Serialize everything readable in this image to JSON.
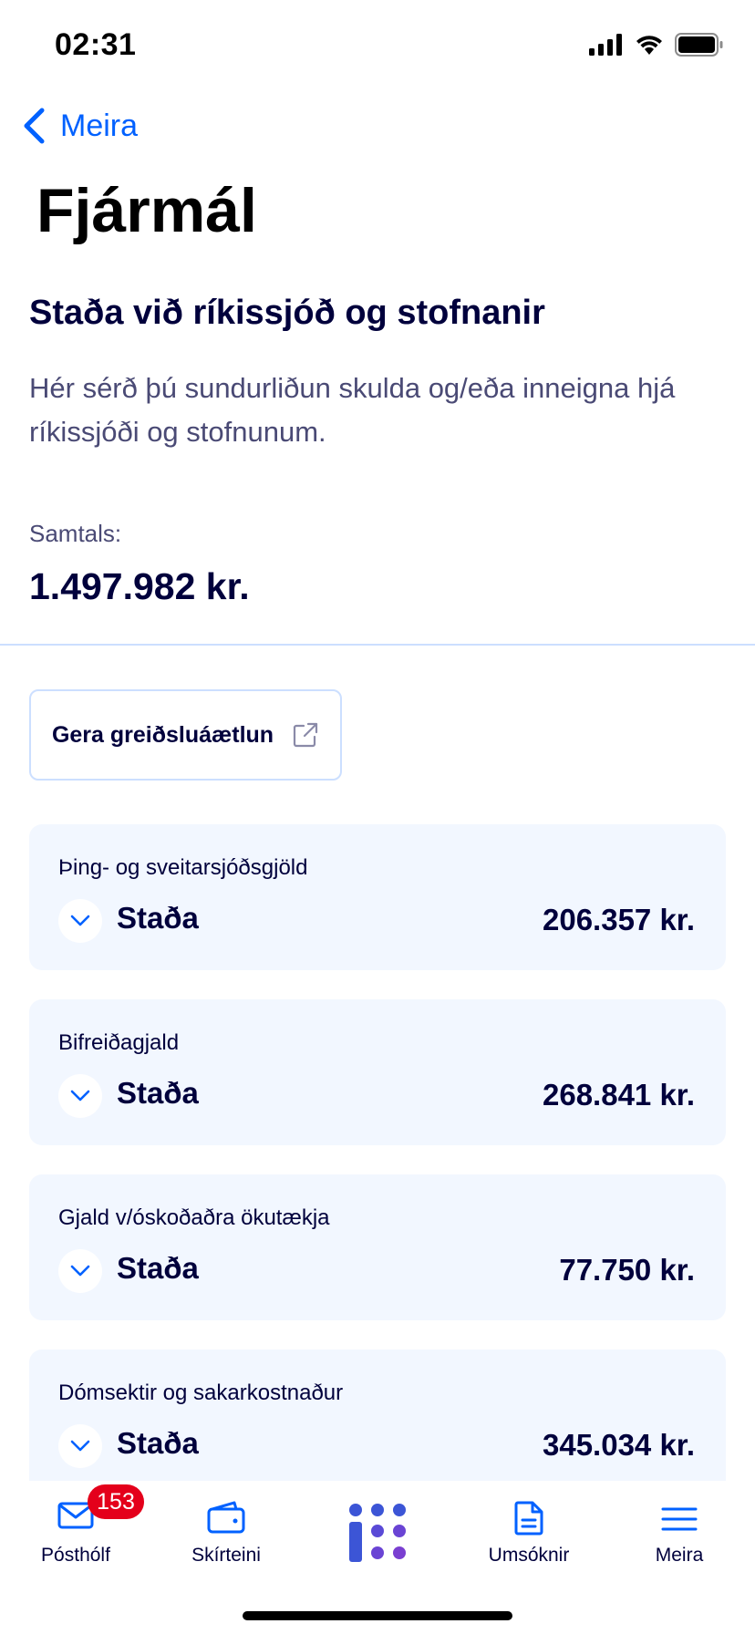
{
  "status_bar": {
    "time": "02:31"
  },
  "nav": {
    "back_label": "Meira"
  },
  "page": {
    "title": "Fjármál"
  },
  "section": {
    "title": "Staða við ríkissjóð og stofnanir",
    "description": "Hér sérð þú sundurliðun skulda og/eða inneigna hjá ríkissjóði og stofnunum."
  },
  "total": {
    "label": "Samtals:",
    "value": "1.497.982 kr."
  },
  "plan_button": {
    "label": "Gera greiðsluáætlun"
  },
  "cards": [
    {
      "label": "Þing- og sveitarsjóðsgjöld",
      "status": "Staða",
      "amount": "206.357 kr."
    },
    {
      "label": "Bifreiðagjald",
      "status": "Staða",
      "amount": "268.841 kr."
    },
    {
      "label": "Gjald v/óskoðaðra ökutækja",
      "status": "Staða",
      "amount": "77.750 kr."
    },
    {
      "label": "Dómsektir og sakarkostnaður",
      "status": "Staða",
      "amount": "345.034 kr."
    }
  ],
  "tabs": [
    {
      "label": "Pósthólf",
      "icon": "mail-icon",
      "badge": "153"
    },
    {
      "label": "Skírteini",
      "icon": "wallet-icon"
    },
    {
      "label": "",
      "icon": "island-logo-icon"
    },
    {
      "label": "Umsóknir",
      "icon": "document-icon"
    },
    {
      "label": "Meira",
      "icon": "menu-icon"
    }
  ],
  "colors": {
    "accent": "#0061ff",
    "primary_text": "#00003c",
    "card_bg": "#f2f7ff",
    "badge": "#e4001b",
    "logo_blue": "#3c55d6",
    "logo_purple": "#7a3fd1"
  }
}
